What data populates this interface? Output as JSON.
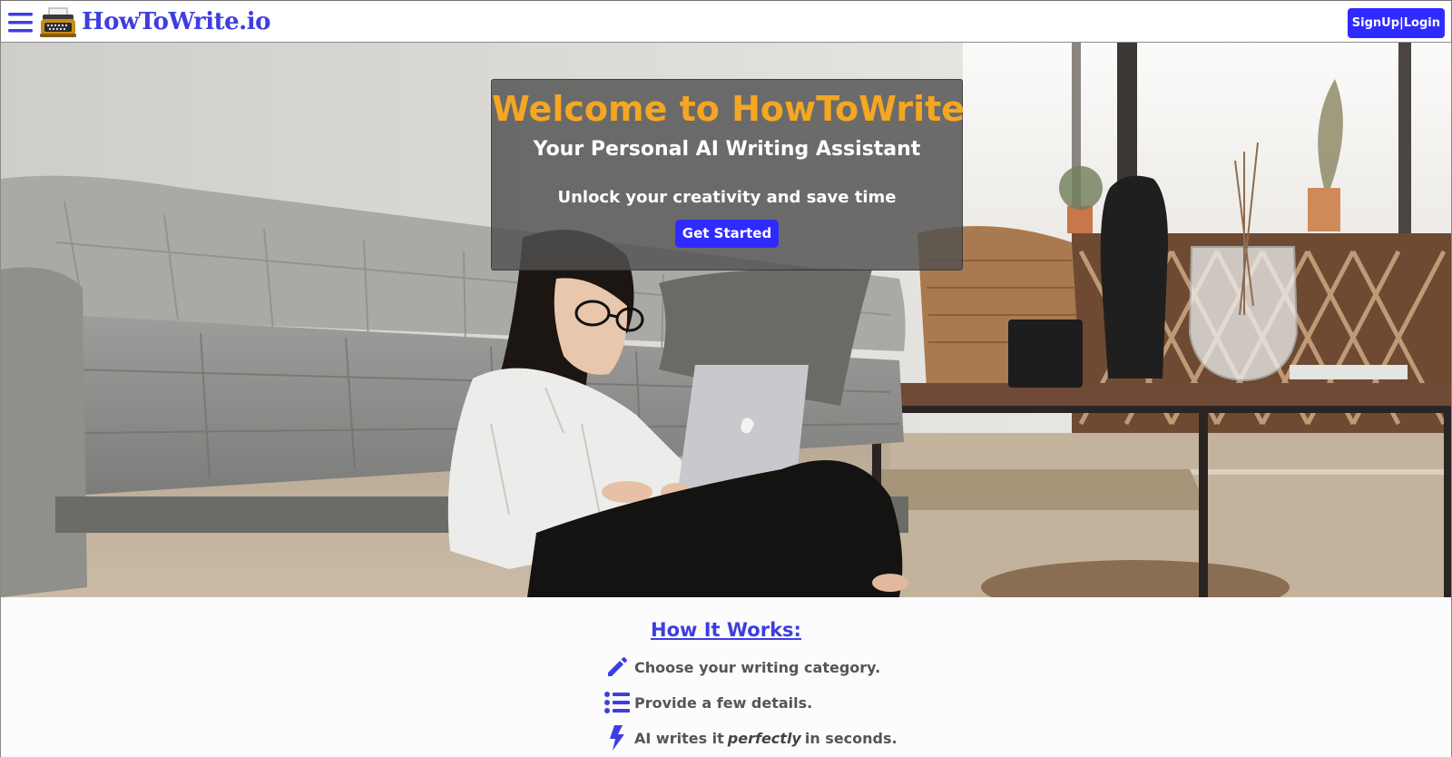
{
  "header": {
    "brand": "HowToWrite.io",
    "auth_label": "SignUp|Login",
    "menu_icon": "hamburger-menu-icon",
    "logo_icon": "typewriter-logo-icon"
  },
  "hero": {
    "title": "Welcome to HowToWrite",
    "subtitle": "Your Personal AI Writing Assistant",
    "tagline": "Unlock your creativity and save time",
    "cta_label": "Get Started",
    "image": "woman-with-laptop-on-floor-by-sofa"
  },
  "how_it_works": {
    "title": "How It Works:",
    "steps": [
      {
        "icon": "pencil-icon",
        "text": "Choose your writing category."
      },
      {
        "icon": "list-icon",
        "text": "Provide a few details."
      },
      {
        "icon": "lightning-bolt-icon",
        "text_before": "AI writes it",
        "emphasis": "perfectly",
        "text_after": "in seconds."
      }
    ]
  },
  "colors": {
    "brand_blue": "#3f3de0",
    "button_blue": "#2f2bff",
    "hero_title_orange": "#f5a623",
    "step_text_gray": "#555555"
  }
}
